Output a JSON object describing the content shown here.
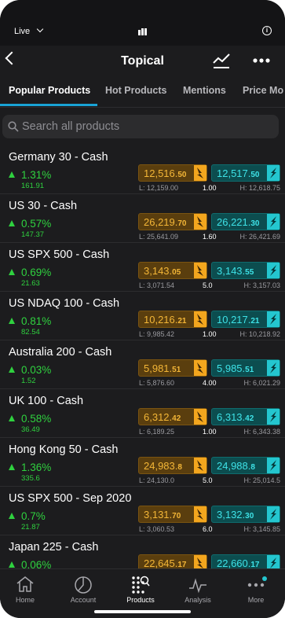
{
  "status_bar": {
    "mode_label": "Live"
  },
  "header": {
    "title": "Topical"
  },
  "tabs": [
    {
      "label": "Popular Products",
      "active": true
    },
    {
      "label": "Hot Products",
      "active": false
    },
    {
      "label": "Mentions",
      "active": false
    },
    {
      "label": "Price Mo",
      "active": false
    }
  ],
  "search": {
    "placeholder": "Search all products"
  },
  "colors": {
    "up": "#2fd13f",
    "sell": "#f3a61e",
    "buy": "#24c6cf",
    "accent": "#19a3d6"
  },
  "products": [
    {
      "name": "Germany 30 - Cash",
      "change_pct": "1.31%",
      "change_abs": "161.91",
      "sell_main": "12,516.",
      "sell_small": "50",
      "buy_main": "12,517.",
      "buy_small": "50",
      "low": "L: 12,159.00",
      "spread": "1.00",
      "high": "H: 12,618.75"
    },
    {
      "name": "US 30 - Cash",
      "change_pct": "0.57%",
      "change_abs": "147.37",
      "sell_main": "26,219.",
      "sell_small": "70",
      "buy_main": "26,221.",
      "buy_small": "30",
      "low": "L: 25,641.09",
      "spread": "1.60",
      "high": "H: 26,421.69"
    },
    {
      "name": "US SPX 500 - Cash",
      "change_pct": "0.69%",
      "change_abs": "21.63",
      "sell_main": "3,143.",
      "sell_small": "05",
      "buy_main": "3,143.",
      "buy_small": "55",
      "low": "L: 3,071.54",
      "spread": "5.0",
      "high": "H: 3,157.03"
    },
    {
      "name": "US NDAQ 100 - Cash",
      "change_pct": "0.81%",
      "change_abs": "82.54",
      "sell_main": "10,216.",
      "sell_small": "21",
      "buy_main": "10,217.",
      "buy_small": "21",
      "low": "L: 9,985.42",
      "spread": "1.00",
      "high": "H: 10,218.92"
    },
    {
      "name": "Australia 200 - Cash",
      "change_pct": "0.03%",
      "change_abs": "1.52",
      "sell_main": "5,981.",
      "sell_small": "51",
      "buy_main": "5,985.",
      "buy_small": "51",
      "low": "L: 5,876.60",
      "spread": "4.00",
      "high": "H: 6,021.29"
    },
    {
      "name": "UK 100 - Cash",
      "change_pct": "0.58%",
      "change_abs": "36.49",
      "sell_main": "6,312.",
      "sell_small": "42",
      "buy_main": "6,313.",
      "buy_small": "42",
      "low": "L: 6,189.25",
      "spread": "1.00",
      "high": "H: 6,343.38"
    },
    {
      "name": "Hong Kong 50 - Cash",
      "change_pct": "1.36%",
      "change_abs": "335.6",
      "sell_main": "24,983.",
      "sell_small": "8",
      "buy_main": "24,988.",
      "buy_small": "8",
      "low": "L: 24,130.0",
      "spread": "5.0",
      "high": "H: 25,014.5"
    },
    {
      "name": "US SPX 500 - Sep 2020",
      "change_pct": "0.7%",
      "change_abs": "21.87",
      "sell_main": "3,131.",
      "sell_small": "70",
      "buy_main": "3,132.",
      "buy_small": "30",
      "low": "L: 3,060.53",
      "spread": "6.0",
      "high": "H: 3,145.85"
    },
    {
      "name": "Japan 225 - Cash",
      "change_pct": "0.06%",
      "change_abs": "",
      "sell_main": "22,645.",
      "sell_small": "17",
      "buy_main": "22,660.",
      "buy_small": "17",
      "low": "",
      "spread": "",
      "high": ""
    }
  ],
  "tab_bar": [
    {
      "label": "Home",
      "icon": "home-icon",
      "active": false
    },
    {
      "label": "Account",
      "icon": "account-icon",
      "active": false
    },
    {
      "label": "Products",
      "icon": "products-icon",
      "active": true
    },
    {
      "label": "Analysis",
      "icon": "analysis-icon",
      "active": false
    },
    {
      "label": "More",
      "icon": "more-icon",
      "active": false
    }
  ]
}
